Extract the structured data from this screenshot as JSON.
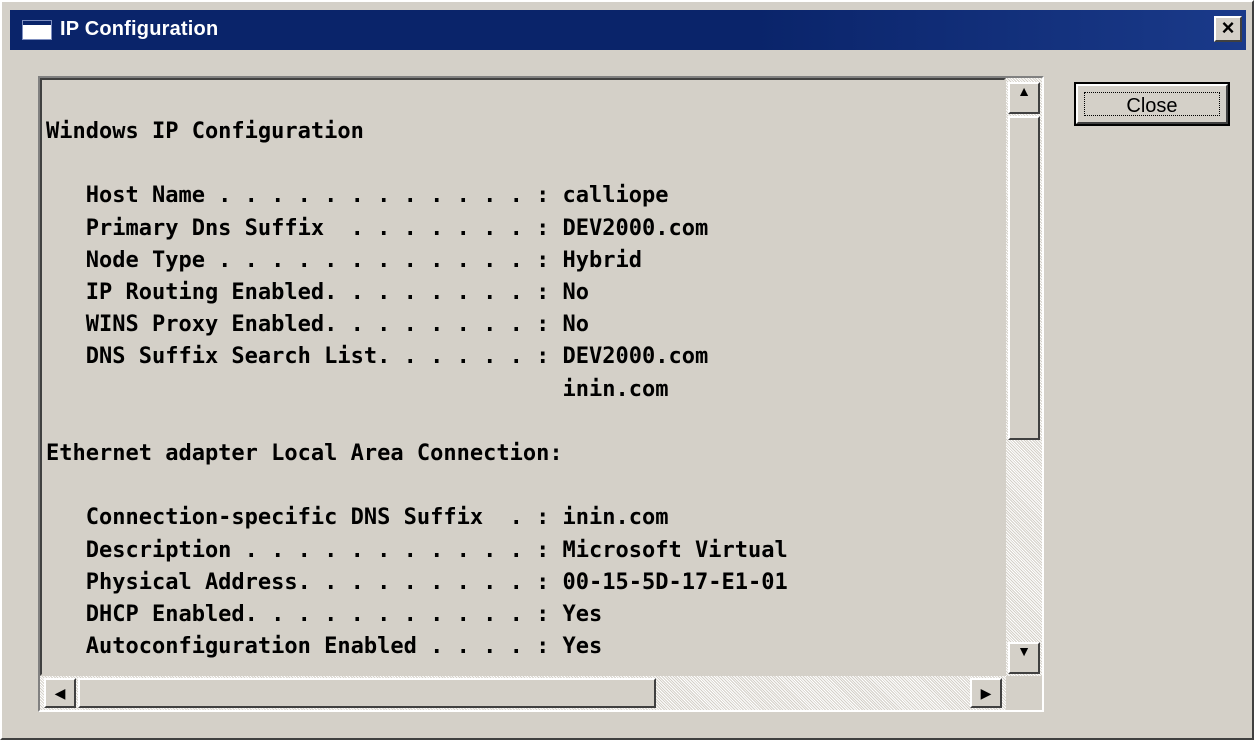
{
  "window": {
    "title": "IP Configuration",
    "close_glyph": "×"
  },
  "console": {
    "lines": [
      "Windows IP Configuration",
      "",
      "   Host Name . . . . . . . . . . . . : calliope",
      "   Primary Dns Suffix  . . . . . . . : DEV2000.com",
      "   Node Type . . . . . . . . . . . . : Hybrid",
      "   IP Routing Enabled. . . . . . . . : No",
      "   WINS Proxy Enabled. . . . . . . . : No",
      "   DNS Suffix Search List. . . . . . : DEV2000.com",
      "                                       inin.com",
      "",
      "Ethernet adapter Local Area Connection:",
      "",
      "   Connection-specific DNS Suffix  . : inin.com",
      "   Description . . . . . . . . . . . : Microsoft Virtual",
      "   Physical Address. . . . . . . . . : 00-15-5D-17-E1-01",
      "   DHCP Enabled. . . . . . . . . . . : Yes",
      "   Autoconfiguration Enabled . . . . : Yes"
    ]
  },
  "buttons": {
    "close_label": "Close"
  },
  "icons": {
    "up": "▲",
    "down": "▼",
    "left": "◀",
    "right": "▶"
  }
}
